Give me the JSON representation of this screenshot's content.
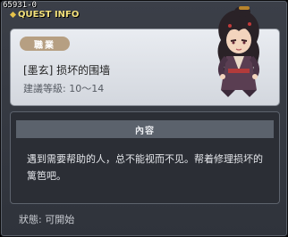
{
  "window": {
    "quest_id": "65931-0",
    "title": "QUEST INFO"
  },
  "info": {
    "job_label": "職業",
    "quest_name": "[墨玄] 损坏的围墙",
    "level_label": "建議等級:",
    "level_range": "10～14"
  },
  "content": {
    "header": "內容",
    "text": "遇到需要帮助的人，总不能视而不见。帮着修理损坏的篱笆吧。"
  },
  "status": {
    "label": "狀態:",
    "value": "可開始"
  },
  "colors": {
    "title": "#f2e07a",
    "badge": "#b69f82",
    "panel_light": "#e1e4e9",
    "panel_dark": "#2b2e35",
    "header_bar": "#5b626c"
  }
}
